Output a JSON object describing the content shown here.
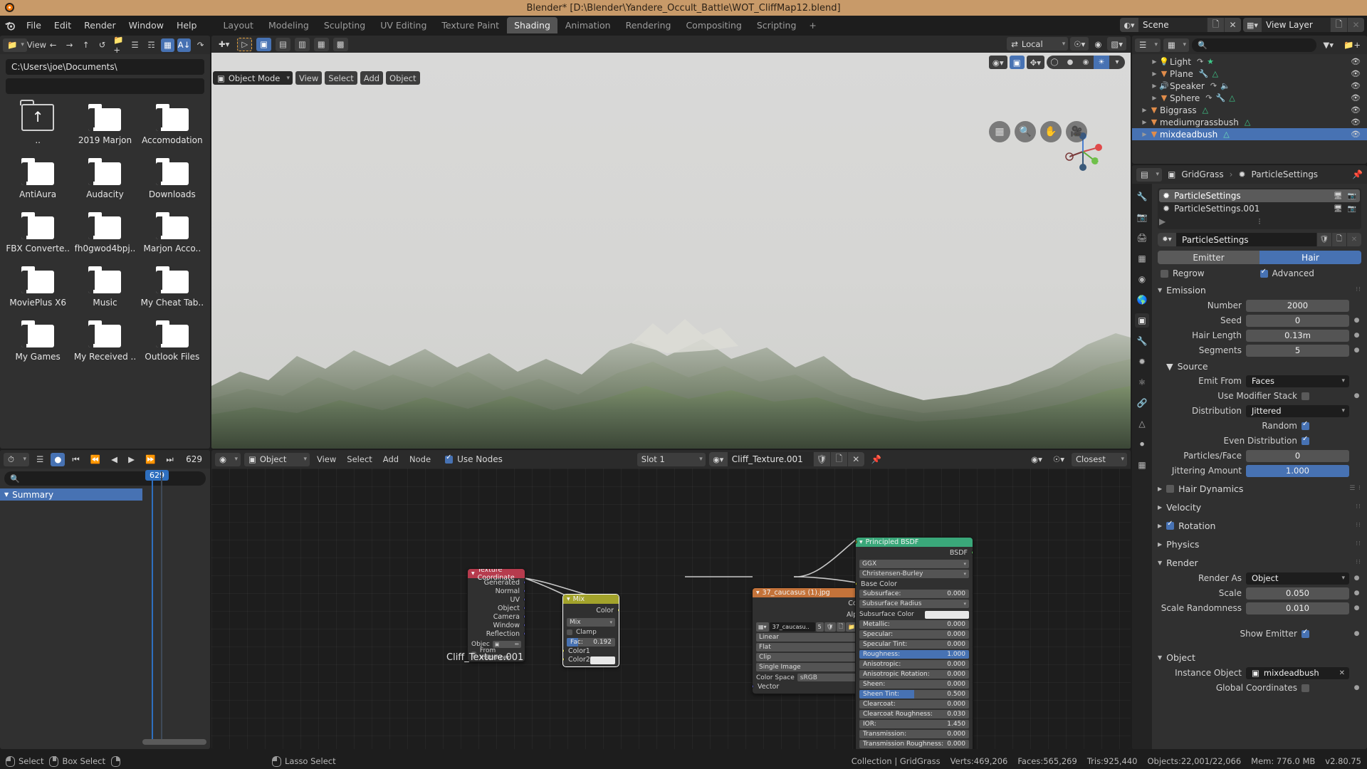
{
  "window": {
    "title": "Blender* [D:\\Blender\\Yandere_Occult_Battle\\WOT_CliffMap12.blend]"
  },
  "topbar": {
    "menus": [
      "File",
      "Edit",
      "Render",
      "Window",
      "Help"
    ],
    "workspaces": [
      {
        "label": "Layout",
        "active": false
      },
      {
        "label": "Modeling",
        "active": false
      },
      {
        "label": "Sculpting",
        "active": false
      },
      {
        "label": "UV Editing",
        "active": false
      },
      {
        "label": "Texture Paint",
        "active": false
      },
      {
        "label": "Shading",
        "active": true
      },
      {
        "label": "Animation",
        "active": false
      },
      {
        "label": "Rendering",
        "active": false
      },
      {
        "label": "Compositing",
        "active": false
      },
      {
        "label": "Scripting",
        "active": false
      },
      {
        "label": "+",
        "active": false
      }
    ],
    "scene_name": "Scene",
    "viewlayer_name": "View Layer"
  },
  "filebrowser": {
    "view_label": "View",
    "path": "C:\\Users\\joe\\Documents\\",
    "filter_value": "",
    "items": [
      {
        "label": "..",
        "type": "parent"
      },
      {
        "label": "2019 Marjon",
        "type": "folder"
      },
      {
        "label": "Accomodation",
        "type": "folder"
      },
      {
        "label": "AntiAura",
        "type": "folder"
      },
      {
        "label": "Audacity",
        "type": "folder"
      },
      {
        "label": "Downloads",
        "type": "folder"
      },
      {
        "label": "FBX Converte..",
        "type": "folder"
      },
      {
        "label": "fh0gwod4bpj..",
        "type": "folder"
      },
      {
        "label": "Marjon Acco..",
        "type": "folder"
      },
      {
        "label": "MoviePlus X6",
        "type": "folder"
      },
      {
        "label": "Music",
        "type": "folder"
      },
      {
        "label": "My Cheat Tab..",
        "type": "folder"
      },
      {
        "label": "My Games",
        "type": "folder"
      },
      {
        "label": "My Received ..",
        "type": "folder"
      },
      {
        "label": "Outlook Files",
        "type": "folder"
      }
    ]
  },
  "viewport": {
    "mode": "Object Mode",
    "menus": [
      "View",
      "Select",
      "Add",
      "Object"
    ],
    "transform_orientation": "Local"
  },
  "outliner": {
    "search_placeholder": "",
    "rows": [
      {
        "label": "Light",
        "icon": "light-icon",
        "modifiers": [
          "anim-icon",
          "light-data-icon"
        ],
        "indent": 2,
        "selected": false
      },
      {
        "label": "Plane",
        "icon": "mesh-icon",
        "modifiers": [
          "wrench-icon",
          "mesh-data-icon"
        ],
        "indent": 2,
        "selected": false
      },
      {
        "label": "Speaker",
        "icon": "speaker-icon",
        "modifiers": [
          "anim-icon",
          "speaker-data-icon"
        ],
        "indent": 2,
        "selected": false
      },
      {
        "label": "Sphere",
        "icon": "mesh-icon",
        "modifiers": [
          "anim-icon",
          "wrench-icon",
          "mesh-data-icon"
        ],
        "indent": 2,
        "selected": false
      },
      {
        "label": "Biggrass",
        "icon": "mesh-icon",
        "modifiers": [
          "mesh-data-icon"
        ],
        "indent": 1,
        "selected": false
      },
      {
        "label": "mediumgrassbush",
        "icon": "mesh-icon",
        "modifiers": [
          "mesh-data-icon"
        ],
        "indent": 1,
        "selected": false
      },
      {
        "label": "mixdeadbush",
        "icon": "mesh-icon",
        "modifiers": [
          "mesh-data-icon"
        ],
        "indent": 1,
        "selected": true
      }
    ]
  },
  "properties": {
    "breadcrumb": [
      "GridGrass",
      "ParticleSettings"
    ],
    "system_list": [
      {
        "label": "ParticleSettings",
        "selected": true
      },
      {
        "label": "ParticleSettings.001",
        "selected": false
      }
    ],
    "datablock_name": "ParticleSettings",
    "type_toggle": [
      {
        "label": "Emitter",
        "active": false
      },
      {
        "label": "Hair",
        "active": true
      }
    ],
    "regrow": {
      "label": "Regrow",
      "checked": false
    },
    "advanced": {
      "label": "Advanced",
      "checked": true
    },
    "panels": {
      "emission": {
        "title": "Emission",
        "fields": [
          {
            "label": "Number",
            "value": "2000",
            "slider": false,
            "has_dot": false
          },
          {
            "label": "Seed",
            "value": "0",
            "slider": false,
            "has_dot": true
          },
          {
            "label": "Hair Length",
            "value": "0.13m",
            "slider": false,
            "has_dot": true
          },
          {
            "label": "Segments",
            "value": "5",
            "slider": false,
            "has_dot": true
          }
        ]
      },
      "source": {
        "title": "Source",
        "emit_from_label": "Emit From",
        "emit_from_value": "Faces",
        "use_modifier_stack": {
          "label": "Use Modifier Stack",
          "checked": false
        },
        "distribution_label": "Distribution",
        "distribution_value": "Jittered",
        "random": {
          "label": "Random",
          "checked": true
        },
        "even_distribution": {
          "label": "Even Distribution",
          "checked": true
        },
        "particles_face": {
          "label": "Particles/Face",
          "value": "0"
        },
        "jittering_amount": {
          "label": "Jittering Amount",
          "value": "1.000",
          "fill_pct": 100
        }
      },
      "hair_dynamics": {
        "title": "Hair Dynamics",
        "checked": false
      },
      "velocity": {
        "title": "Velocity"
      },
      "rotation": {
        "title": "Rotation",
        "checked": true
      },
      "physics": {
        "title": "Physics"
      },
      "render": {
        "title": "Render",
        "render_as_label": "Render As",
        "render_as_value": "Object",
        "scale": {
          "label": "Scale",
          "value": "0.050"
        },
        "scale_randomness": {
          "label": "Scale Randomness",
          "value": "0.010"
        },
        "show_emitter": {
          "label": "Show Emitter",
          "checked": true
        }
      },
      "object": {
        "title": "Object",
        "instance_object_label": "Instance Object",
        "instance_object_value": "mixdeadbush",
        "global_coordinates": {
          "label": "Global Coordinates",
          "checked": false
        }
      }
    }
  },
  "timeline": {
    "current_frame": "629",
    "playhead_label": "629",
    "summary_label": "Summary"
  },
  "shader_editor": {
    "mode": "Object",
    "menus": [
      "View",
      "Select",
      "Add",
      "Node"
    ],
    "use_nodes": {
      "label": "Use Nodes",
      "checked": true
    },
    "slot": "Slot 1",
    "material": "Cliff_Texture.001",
    "snap_mode": "Closest",
    "material_label": "Cliff_Texture.001",
    "nodes": [
      {
        "id": "texcoord",
        "title": "Texture Coordinate",
        "header_color": "#b63b4d",
        "outputs": [
          "Generated",
          "Normal",
          "UV",
          "Object",
          "Camera",
          "Window",
          "Reflection"
        ],
        "object_label": "Objec",
        "from_instancer": {
          "label": "From Instancer",
          "checked": false
        }
      },
      {
        "id": "mix",
        "title": "Mix",
        "header_color": "#a3a32b",
        "outputs": [
          "Color"
        ],
        "blend_mode": "Mix",
        "clamp": {
          "label": "Clamp",
          "checked": false
        },
        "fac": {
          "label": "Fac:",
          "value": "0.192",
          "fill_pct": 24
        },
        "inputs": [
          "Color1",
          "Color2"
        ]
      },
      {
        "id": "imagetex",
        "title": "37_caucasus (1).jpg",
        "header_color": "#c4733a",
        "outputs": [
          "Color",
          "Alpha"
        ],
        "image_name": "37_caucasu..",
        "image_users": "5",
        "interpolation": "Linear",
        "projection": "Flat",
        "extension": "Clip",
        "source": "Single Image",
        "colorspace_label": "Color Space",
        "colorspace_value": "sRGB",
        "inputs": [
          "Vector"
        ]
      },
      {
        "id": "bsdf",
        "title": "Principled BSDF",
        "header_color": "#3aa87a",
        "outputs": [
          "BSDF"
        ],
        "distribution": "GGX",
        "subsurface_method": "Christensen-Burley",
        "rows": [
          {
            "label": "Base Color",
            "value": "",
            "kind": "socket",
            "socket": "s-yellow"
          },
          {
            "label": "Subsurface:",
            "value": "0.000",
            "kind": "slider"
          },
          {
            "label": "Subsurface Radius",
            "value": "",
            "kind": "dropdown",
            "socket": "s-violet"
          },
          {
            "label": "Subsurface Color",
            "value": "",
            "kind": "swatch",
            "socket": "s-yellow"
          },
          {
            "label": "Metallic:",
            "value": "0.000",
            "kind": "slider"
          },
          {
            "label": "Specular:",
            "value": "0.000",
            "kind": "slider"
          },
          {
            "label": "Specular Tint:",
            "value": "0.000",
            "kind": "slider"
          },
          {
            "label": "Roughness:",
            "value": "1.000",
            "kind": "slider",
            "fill_pct": 100
          },
          {
            "label": "Anisotropic:",
            "value": "0.000",
            "kind": "slider"
          },
          {
            "label": "Anisotropic Rotation:",
            "value": "0.000",
            "kind": "slider"
          },
          {
            "label": "Sheen:",
            "value": "0.000",
            "kind": "slider"
          },
          {
            "label": "Sheen Tint:",
            "value": "0.500",
            "kind": "slider",
            "fill_pct": 50
          },
          {
            "label": "Clearcoat:",
            "value": "0.000",
            "kind": "slider"
          },
          {
            "label": "Clearcoat Roughness:",
            "value": "0.030",
            "kind": "slider"
          },
          {
            "label": "IOR:",
            "value": "1.450",
            "kind": "value"
          },
          {
            "label": "Transmission:",
            "value": "0.000",
            "kind": "slider"
          },
          {
            "label": "Transmission Roughness:",
            "value": "0.000",
            "kind": "slider"
          }
        ]
      }
    ]
  },
  "statusbar": {
    "hints": [
      {
        "mouse": "l",
        "label": "Select"
      },
      {
        "mouse": "m",
        "label": "Box Select"
      },
      {
        "mouse": "r",
        "label": ""
      },
      {
        "mouse": "l",
        "label": "Lasso Select"
      }
    ],
    "collection": "Collection | GridGrass",
    "verts": "Verts:469,206",
    "faces": "Faces:565,269",
    "tris": "Tris:925,440",
    "objects": "Objects:22,001/22,066",
    "mem": "Mem: 776.0 MB",
    "version": "v2.80.75"
  }
}
